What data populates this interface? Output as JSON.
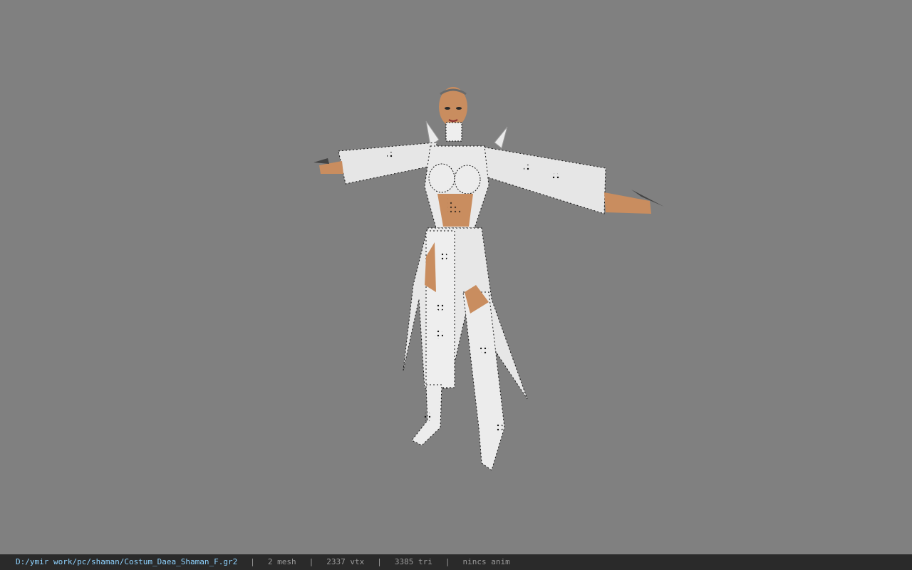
{
  "viewport": {
    "background": "#808080",
    "model_name": "3d-character-model"
  },
  "statusbar": {
    "path": "D:/ymir work/pc/shaman/Costum_Daea_Shaman_F.gr2",
    "separator": "|",
    "mesh": "2 mesh",
    "vertices": "2337 vtx",
    "triangles": "3385 tri",
    "anim": "nincs anim"
  },
  "colors": {
    "statusbar_bg": "#2a2a2a",
    "path_text": "#8fd3ff",
    "stat_text": "#9a9a9a",
    "skin": "#c98d5f",
    "costume": "#e8e8e8"
  }
}
